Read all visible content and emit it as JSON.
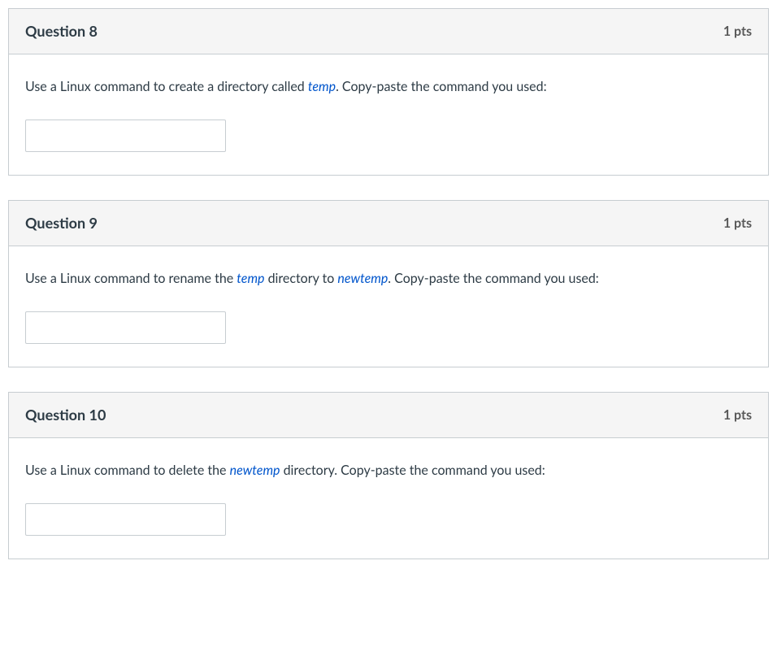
{
  "questions": [
    {
      "title": "Question 8",
      "points": "1 pts",
      "prompt_before": "Use a Linux command to create a directory called ",
      "em1": "temp",
      "prompt_mid": "",
      "em2": "",
      "prompt_after": ". Copy-paste the command you used:",
      "answer_value": ""
    },
    {
      "title": "Question 9",
      "points": "1 pts",
      "prompt_before": "Use a Linux command to rename the ",
      "em1": "temp",
      "prompt_mid": " directory to ",
      "em2": "newtemp",
      "prompt_after": ". Copy-paste the command you used:",
      "answer_value": ""
    },
    {
      "title": "Question 10",
      "points": "1 pts",
      "prompt_before": "Use a Linux command to delete the ",
      "em1": "newtemp",
      "prompt_mid": "",
      "em2": "",
      "prompt_after": " directory. Copy-paste the command you used:",
      "answer_value": ""
    }
  ]
}
